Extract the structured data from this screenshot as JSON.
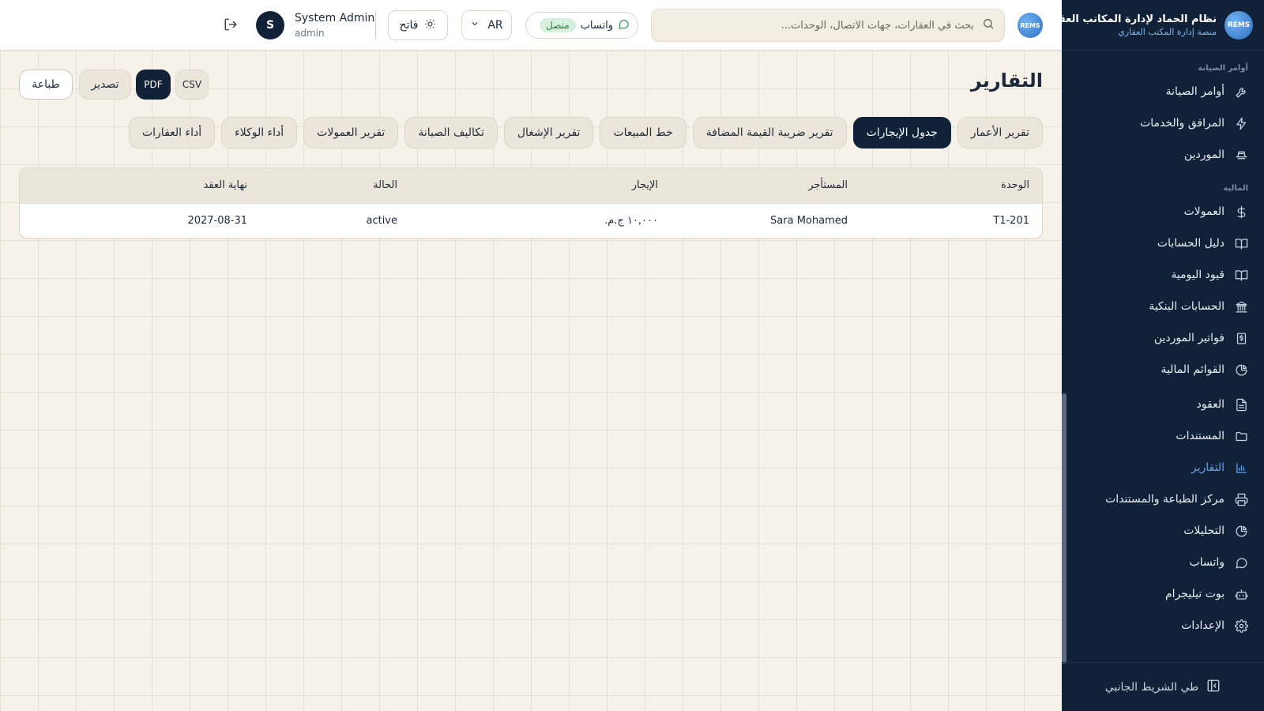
{
  "brand": {
    "logo_text": "REMS",
    "title": "نظام الحماد لإدارة المكاتب العقارية",
    "subtitle": "منصة إدارة المكتب العقاري"
  },
  "sidebar": {
    "sections": [
      {
        "label": "أوامر الصيانة"
      },
      {
        "label": "المالية"
      }
    ],
    "items": [
      {
        "label": "أوامر الصيانة",
        "icon": "wrench-icon"
      },
      {
        "label": "المرافق والخدمات",
        "icon": "lightning-icon"
      },
      {
        "label": "الموردين",
        "icon": "truck-icon"
      },
      {
        "label": "العمولات",
        "icon": "dollar-icon"
      },
      {
        "label": "دليل الحسابات",
        "icon": "book-icon"
      },
      {
        "label": "قيود اليومية",
        "icon": "book-open-icon"
      },
      {
        "label": "الحسابات البنكية",
        "icon": "bank-icon"
      },
      {
        "label": "فواتير الموردين",
        "icon": "invoice-icon"
      },
      {
        "label": "القوائم المالية",
        "icon": "pie-chart-icon"
      },
      {
        "label": "العقود",
        "icon": "document-icon"
      },
      {
        "label": "المستندات",
        "icon": "folder-icon"
      },
      {
        "label": "التقارير",
        "icon": "bar-chart-icon",
        "active": true
      },
      {
        "label": "مركز الطباعة والمستندات",
        "icon": "printer-icon"
      },
      {
        "label": "التحليلات",
        "icon": "analytics-icon"
      },
      {
        "label": "واتساب",
        "icon": "chat-icon"
      },
      {
        "label": "بوت تيليجرام",
        "icon": "bot-icon"
      },
      {
        "label": "الإعدادات",
        "icon": "gear-icon"
      }
    ],
    "collapse_label": "طي الشريط الجانبي"
  },
  "topbar": {
    "search_placeholder": "بحث في العقارات، جهات الاتصال، الوحدات...",
    "whatsapp_label": "واتساب",
    "whatsapp_status": "متصل",
    "language": "AR",
    "theme_label": "فاتح",
    "user_name": "System Admin",
    "user_role": "admin",
    "avatar_initial": "S"
  },
  "page": {
    "title": "التقارير",
    "actions": {
      "print": "طباعة",
      "export": "تصدير",
      "pdf": "PDF",
      "csv": "CSV"
    },
    "tabs": [
      {
        "label": "تقرير الأعمار"
      },
      {
        "label": "جدول الإيجارات",
        "active": true
      },
      {
        "label": "تقرير ضريبة القيمة المضافة"
      },
      {
        "label": "خط المبيعات"
      },
      {
        "label": "تقرير الإشغال"
      },
      {
        "label": "تكاليف الصيانة"
      },
      {
        "label": "تقرير العمولات"
      },
      {
        "label": "أداء الوكلاء"
      },
      {
        "label": "أداء العقارات"
      }
    ],
    "table": {
      "headers": [
        "الوحدة",
        "المستأجر",
        "الإيجار",
        "الحالة",
        "نهاية العقد"
      ],
      "rows": [
        [
          "T1-201",
          "Sara Mohamed",
          "١٠,٠٠٠ ج.م.",
          "active",
          "2027-08-31"
        ]
      ]
    }
  },
  "colors": {
    "sidebar_bg": "#112238",
    "accent": "#5ea6f0",
    "page_bg": "#f6f2ea",
    "active_tab": "#112238",
    "status_ok": "#2c7d48"
  }
}
